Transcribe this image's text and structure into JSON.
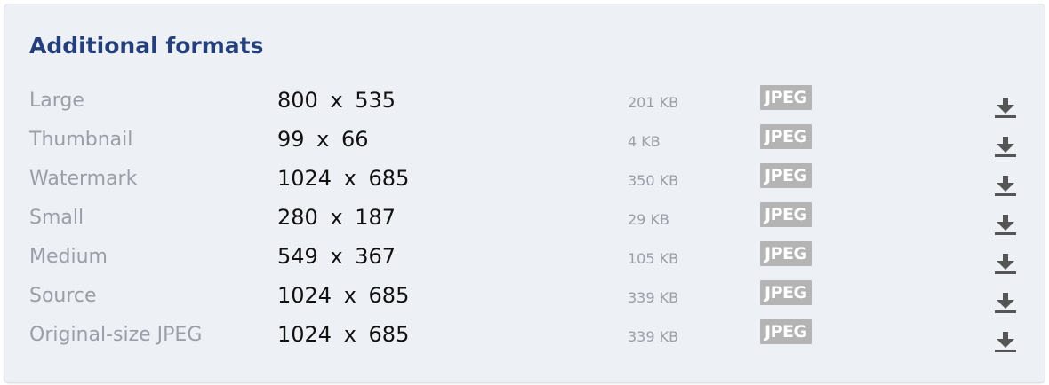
{
  "panel": {
    "title": "Additional formats"
  },
  "formats": [
    {
      "name": "Large",
      "dimensions": "800 x 535",
      "file_size": "201 KB",
      "type": "JPEG"
    },
    {
      "name": "Thumbnail",
      "dimensions": "99 x 66",
      "file_size": "4 KB",
      "type": "JPEG"
    },
    {
      "name": "Watermark",
      "dimensions": "1024 x 685",
      "file_size": "350 KB",
      "type": "JPEG"
    },
    {
      "name": "Small",
      "dimensions": "280 x 187",
      "file_size": "29 KB",
      "type": "JPEG"
    },
    {
      "name": "Medium",
      "dimensions": "549 x 367",
      "file_size": "105 KB",
      "type": "JPEG"
    },
    {
      "name": "Source",
      "dimensions": "1024 x 685",
      "file_size": "339 KB",
      "type": "JPEG"
    },
    {
      "name": "Original-size JPEG",
      "dimensions": "1024 x 685",
      "file_size": "339 KB",
      "type": "JPEG"
    }
  ],
  "icons": {
    "download": "download-icon"
  },
  "colors": {
    "title": "#253f7a",
    "panel_background": "#edf0f5",
    "label_gray": "#9a9ea6",
    "badge_background": "#b4b4b4",
    "icon": "#555555"
  }
}
